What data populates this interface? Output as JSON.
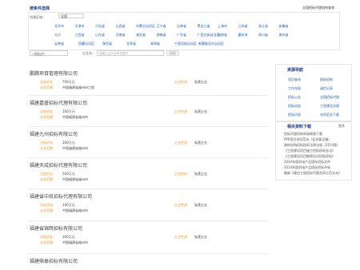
{
  "filter": {
    "title": "按条件选择",
    "top_link": "全国招标代理机构查询",
    "region_label": "所属区域：",
    "region_value": "全国",
    "keyword_value": "--招标代--",
    "name_label": "企业名：",
    "name_placeholder": "请输入企业名称关键字",
    "search_button": "搜索",
    "row1": [
      "北京市",
      "天津市",
      "河北省",
      "山西省",
      "内蒙古自治区",
      "辽宁省",
      "吉林省",
      "黑龙江省",
      "上海市",
      "江苏省",
      "浙江省",
      "安徽省"
    ],
    "row2": [
      "福建",
      "江西省",
      "山东省",
      "河南省",
      "湖北省",
      "湖南省",
      "广东省",
      "广西壮族自治区",
      "海南省",
      "重庆市",
      "四川省",
      "贵州省"
    ],
    "row3": [
      "云南省",
      "西藏自治区",
      "陕西省",
      "甘肃省",
      "青海省",
      "宁夏回族自治区",
      "新疆维吾尔自治区"
    ]
  },
  "companies": [
    {
      "name": "鹏腾项目管理有限公司",
      "rows": [
        {
          "k1": "注册资金：",
          "v1": "700万元",
          "k2": "企业性质：",
          "v2": "私营企业"
        },
        {
          "k1": "业务范围：",
          "v1": "中国福建省福州市工程"
        }
      ]
    },
    {
      "name": "福建嘉盛招标代理有限公司",
      "rows": [
        {
          "k1": "注册资金：",
          "v1": "100万元",
          "k2": "企业性质：",
          "v2": "私营企业"
        },
        {
          "k1": "业务范围：",
          "v1": "中国福建省福州市"
        }
      ]
    },
    {
      "name": "福建九州招标有限公司",
      "rows": [
        {
          "k1": "注册资金：",
          "v1": "200万元",
          "k2": "企业性质：",
          "v2": "私营企业"
        },
        {
          "k1": "业务范围：",
          "v1": "中国福建省福州市"
        }
      ]
    },
    {
      "name": "福建天成招标代理有限公司",
      "rows": [
        {
          "k1": "注册资金：",
          "v1": "500万元",
          "k2": "企业性质：",
          "v2": "私营企业"
        },
        {
          "k1": "业务范围：",
          "v1": "中国福建省福州市"
        }
      ]
    },
    {
      "name": "福建省中凯招标代理有限公司",
      "rows": [
        {
          "k1": "注册资金：",
          "v1": "100万元",
          "k2": "企业性质：",
          "v2": "私营企业"
        },
        {
          "k1": "业务范围：",
          "v1": "中国福建省福州市"
        }
      ]
    },
    {
      "name": "福建省锦辉招标有限公司",
      "rows": [
        {
          "k1": "注册资金：",
          "v1": "300万元",
          "k2": "企业性质：",
          "v2": "私营企业"
        },
        {
          "k1": "业务范围：",
          "v1": "中国福建省福州市"
        }
      ]
    },
    {
      "name": "福建鼎泰招标有限公司",
      "rows": []
    }
  ],
  "sidebar": {
    "services_title": "资源导航",
    "services": [
      "项目查询",
      "招标机构",
      "工作年报",
      "诚信记录",
      "招标公告",
      "全国招标代理",
      "招标动态",
      "工程建设法规",
      "招标问答",
      "合同范本下载"
    ],
    "downloads_title": "相关资料下载",
    "downloads_more": "更多",
    "downloads": [
      "招标代理机构申请表格下载",
      "PPP项目合同范本（征求意见稿）",
      "政府采购招标投标法律法规（2014版）",
      "《工程建设项目施工招标投标办法》",
      "《工程建设项目勘察设计招标投标》",
      "2014年版机电产品国际招标文件",
      "2014年版机电产品国际招标评标",
      "最新《建设工程招标代理合同示范文本》"
    ]
  }
}
